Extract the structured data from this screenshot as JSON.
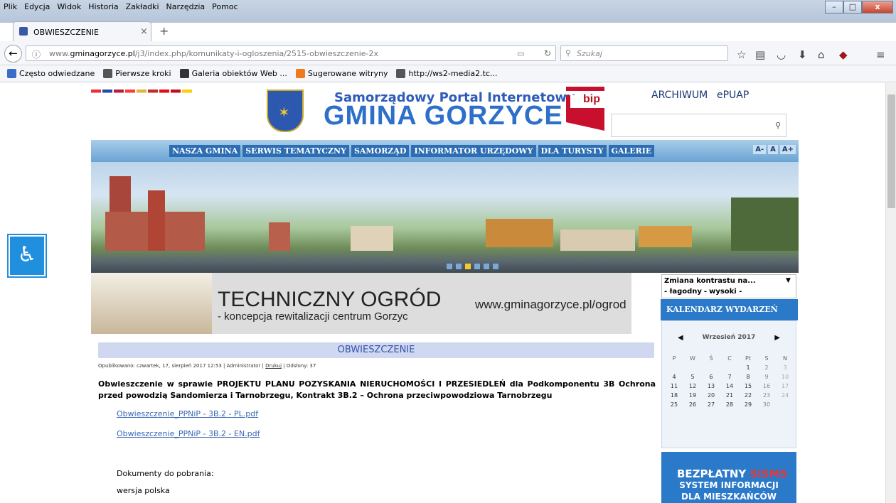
{
  "menu": [
    "Plik",
    "Edycja",
    "Widok",
    "Historia",
    "Zakładki",
    "Narzędzia",
    "Pomoc"
  ],
  "window_buttons": {
    "minimize": "–",
    "maximize": "□",
    "close": "x"
  },
  "tab": {
    "title": "OBWIESZCZENIE",
    "close": "×",
    "new": "+"
  },
  "navbar": {
    "url_prefix": "www.",
    "url_host": "gminagorzyce.pl",
    "url_path": "/j3/index.php/komunikaty-i-ogloszenia/2515-obwieszczenie-2x",
    "search_placeholder": "Szukaj"
  },
  "bookmarks": [
    {
      "label": "Często odwiedzane",
      "color": "#3a6fc9"
    },
    {
      "label": "Pierwsze kroki",
      "color": "#555"
    },
    {
      "label": "Galeria obiektów Web ...",
      "color": "#333"
    },
    {
      "label": "Sugerowane witryny",
      "color": "#f07a1c"
    },
    {
      "label": "http://ws2-media2.tc...",
      "color": "#555"
    }
  ],
  "header": {
    "portal": "Samorządowy Portal Internetowy",
    "gmina": "GMINA GORZYCE",
    "bip": "bip",
    "archiwum": "ARCHIWUM",
    "epuap": "ePUAP"
  },
  "flags": [
    "#e8303a",
    "#1d4fa8",
    "#bb1e3c",
    "#fc3d32",
    "#e0b53b",
    "#c42b2b",
    "#e30a17",
    "#c60b1e",
    "#f6d00a"
  ],
  "nav": [
    "NASZA GMINA",
    "SERWIS TEMATYCZNY",
    "SAMORZĄD",
    "INFORMATOR URZĘDOWY",
    "DLA TURYSTY",
    "GALERIE"
  ],
  "font_sizes": [
    "A-",
    "A",
    "A+"
  ],
  "promo": {
    "title": "TECHNICZNY OGRÓD",
    "subtitle": "- koncepcja rewitalizacji centrum Gorzyc",
    "url": "www.gminagorzyce.pl/ogrod"
  },
  "article": {
    "title": "OBWIESZCZENIE",
    "meta_prefix": "Opublikowano: czwartek, 17, sierpień 2017 12:53 | Administrator | ",
    "meta_print": "Drukuj",
    "meta_suffix": " | Odsłony: 37",
    "body": "Obwieszczenie w sprawie PROJEKTU PLANU POZYSKANIA NIERUCHOMOŚCI I PRZESIEDLEŃ dla Podkomponentu 3B Ochrona przed powodzią Sandomierza i Tarnobrzegu, Kontrakt 3B.2 – Ochrona przeciwpowodziowa Tarnobrzegu",
    "link1": "Obwieszczenie_PPNiP - 3B.2 - PL.pdf",
    "link2": "Obwieszczenie_PPNiP - 3B.2 - EN.pdf",
    "docs": "Dokumenty do pobrania:",
    "version": "wersja polska"
  },
  "sidebar": {
    "contrast_select": "Zmiana kontrastu na...",
    "contrast_opts": [
      "- łagodny",
      "-",
      "wysoki -"
    ],
    "calendar_title": "KALENDARZ WYDARZEŃ",
    "month": "Wrzesień 2017",
    "weekdays": [
      "P",
      "W",
      "Ś",
      "C",
      "Pt",
      "S",
      "N"
    ],
    "days": [
      "",
      "",
      "",
      "",
      "1",
      "2",
      "3",
      "4",
      "5",
      "6",
      "7",
      "8",
      "9",
      "10",
      "11",
      "12",
      "13",
      "14",
      "15",
      "16",
      "17",
      "18",
      "19",
      "20",
      "21",
      "22",
      "23",
      "24",
      "25",
      "26",
      "27",
      "28",
      "29",
      "30",
      ""
    ],
    "sisms1": "BEZPŁATNY",
    "sisms_brand": "SISMS",
    "sisms2": "SYSTEM INFORMACJI",
    "sisms3": "DLA MIESZKAŃCÓW"
  }
}
